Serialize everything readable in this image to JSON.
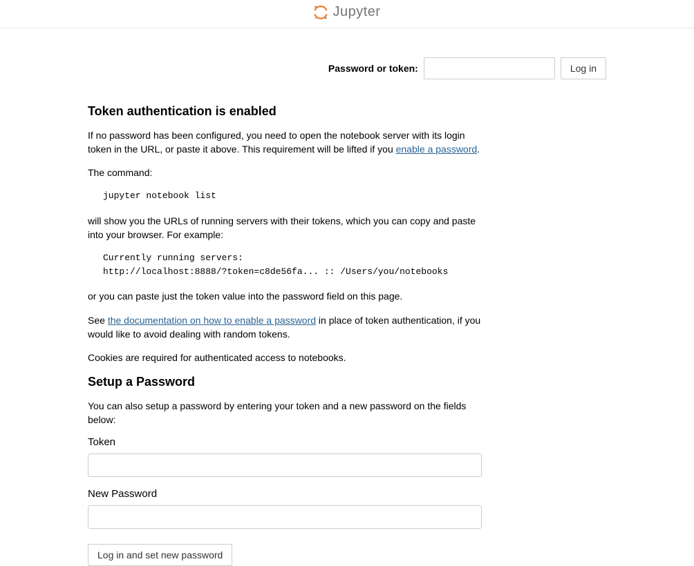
{
  "header": {
    "logo_text": "Jupyter"
  },
  "login": {
    "label": "Password or token:",
    "button": "Log in"
  },
  "auth": {
    "heading": "Token authentication is enabled",
    "para1_a": "If no password has been configured, you need to open the notebook server with its login token in the URL, or paste it above. This requirement will be lifted if you ",
    "para1_link": "enable a password",
    "para1_b": ".",
    "para2": "The command:",
    "cmd1": "jupyter notebook list",
    "para3": "will show you the URLs of running servers with their tokens, which you can copy and paste into your browser. For example:",
    "cmd2": "Currently running servers:\nhttp://localhost:8888/?token=c8de56fa... :: /Users/you/notebooks",
    "para4": "or you can paste just the token value into the password field on this page.",
    "para5_a": "See ",
    "para5_link": "the documentation on how to enable a password",
    "para5_b": " in place of token authentication, if you would like to avoid dealing with random tokens.",
    "para6": "Cookies are required for authenticated access to notebooks."
  },
  "setup": {
    "heading": "Setup a Password",
    "desc": "You can also setup a password by entering your token and a new password on the fields below:",
    "token_label": "Token",
    "password_label": "New Password",
    "button": "Log in and set new password"
  }
}
